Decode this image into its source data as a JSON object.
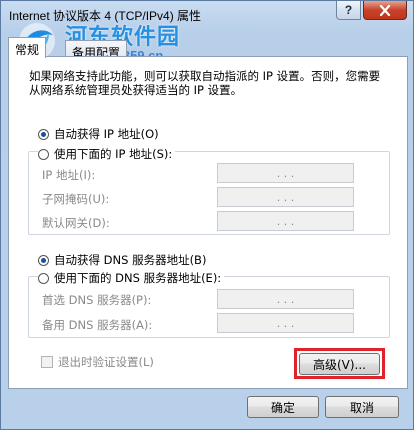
{
  "window": {
    "title": "Internet 协议版本 4 (TCP/IPv4) 属性"
  },
  "titlebar": {
    "help_label": "?",
    "close_icon": "close-icon"
  },
  "watermark": {
    "name": "河东软件园",
    "url": "www.pc0359.cn"
  },
  "tabs": [
    {
      "label": "常规"
    },
    {
      "label": "备用配置"
    }
  ],
  "description": "如果网络支持此功能，则可以获取自动指派的 IP 设置。否则，您需要从网络系统管理员处获得适当的 IP 设置。",
  "ip": {
    "auto_label": "自动获得 IP 地址(O)",
    "manual_label": "使用下面的 IP 地址(S):",
    "selected": "auto",
    "fields": [
      {
        "label": "IP 地址(I):",
        "value": ". . ."
      },
      {
        "label": "子网掩码(U):",
        "value": ". . ."
      },
      {
        "label": "默认网关(D):",
        "value": ". . ."
      }
    ]
  },
  "dns": {
    "auto_label": "自动获得 DNS 服务器地址(B)",
    "manual_label": "使用下面的 DNS 服务器地址(E):",
    "selected": "auto",
    "fields": [
      {
        "label": "首选 DNS 服务器(P):",
        "value": ". . ."
      },
      {
        "label": "备用 DNS 服务器(A):",
        "value": ". . ."
      }
    ]
  },
  "validate_on_exit": {
    "label": "退出时验证设置(L)",
    "checked": false
  },
  "buttons": {
    "advanced": "高级(V)...",
    "ok": "确定",
    "cancel": "取消"
  },
  "colors": {
    "highlight": "#e0222a",
    "title_bg": "#b9d0ea",
    "watermark": "#1c8be0"
  }
}
